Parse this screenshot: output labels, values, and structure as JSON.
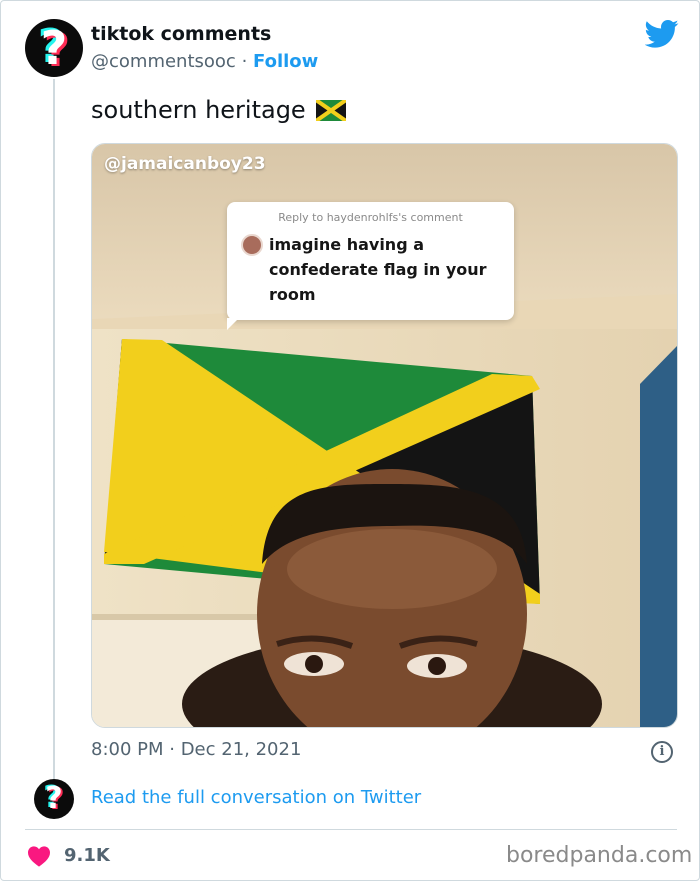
{
  "author": {
    "display_name": "tiktok comments",
    "handle": "@commentsooc",
    "separator": "·",
    "follow_label": "Follow",
    "avatar_glyph": "?"
  },
  "tweet": {
    "text": "southern heritage",
    "emoji": "jamaica-flag-emoji",
    "timestamp": "8:00 PM · Dec 21, 2021"
  },
  "media": {
    "watermark": "@jamaicanboy23",
    "reply_header": "Reply to haydenrohlfs's comment",
    "reply_text": "imagine having a confederate flag in your room"
  },
  "footer": {
    "conversation_link": "Read the full conversation on Twitter",
    "like_count": "9.1K",
    "info_icon_glyph": "i",
    "source": "boredpanda.com"
  },
  "colors": {
    "twitter_blue": "#1d9bf0",
    "like_red": "#f91880",
    "text_secondary": "#536471",
    "flag_green": "#1e8a3a",
    "flag_yellow": "#f2cf1c",
    "flag_black": "#141414"
  },
  "icons": [
    "tiktok-avatar-icon",
    "twitter-bird-icon",
    "jamaica-flag-emoji",
    "info-icon",
    "heart-icon"
  ]
}
